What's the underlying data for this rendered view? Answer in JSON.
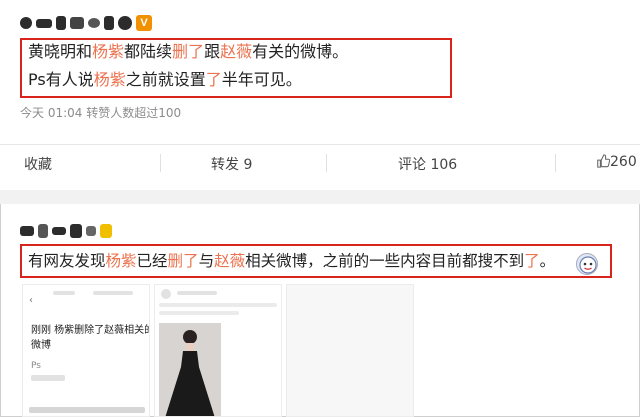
{
  "post1": {
    "text_line1": [
      {
        "t": "黄晓明和",
        "hl": false
      },
      {
        "t": "杨紫",
        "hl": true
      },
      {
        "t": "都陆续",
        "hl": false
      },
      {
        "t": "删了",
        "hl": true
      },
      {
        "t": "跟",
        "hl": false
      },
      {
        "t": "赵薇",
        "hl": true
      },
      {
        "t": "有关的微博。",
        "hl": false
      }
    ],
    "text_line2": [
      {
        "t": "Ps有人说",
        "hl": false
      },
      {
        "t": "杨紫",
        "hl": true
      },
      {
        "t": "之前就设置",
        "hl": false
      },
      {
        "t": "了",
        "hl": true
      },
      {
        "t": "半年可见。",
        "hl": false
      }
    ],
    "meta": "今天 01:04 转赞人数超过100",
    "badge": "V"
  },
  "actions": {
    "collect": "收藏",
    "repost": "转发 9",
    "comment": "评论 106",
    "like": "260"
  },
  "post2": {
    "text": [
      {
        "t": "有网友发现",
        "hl": false
      },
      {
        "t": "杨紫",
        "hl": true
      },
      {
        "t": "已经",
        "hl": false
      },
      {
        "t": "删了",
        "hl": true
      },
      {
        "t": "与",
        "hl": false
      },
      {
        "t": "赵薇",
        "hl": true
      },
      {
        "t": "相关微博，之前的一些内容目前都搜不到",
        "hl": false
      },
      {
        "t": "了",
        "hl": true
      },
      {
        "t": "。",
        "hl": false
      }
    ],
    "thumb1_title": "刚刚 杨紫删除了赵薇相关的所有",
    "thumb1_title2": "微博",
    "thumb1_small": "Ps"
  },
  "colors": {
    "highlight": "#eb7350",
    "box": "#d9231d",
    "badge": "#f29100"
  }
}
